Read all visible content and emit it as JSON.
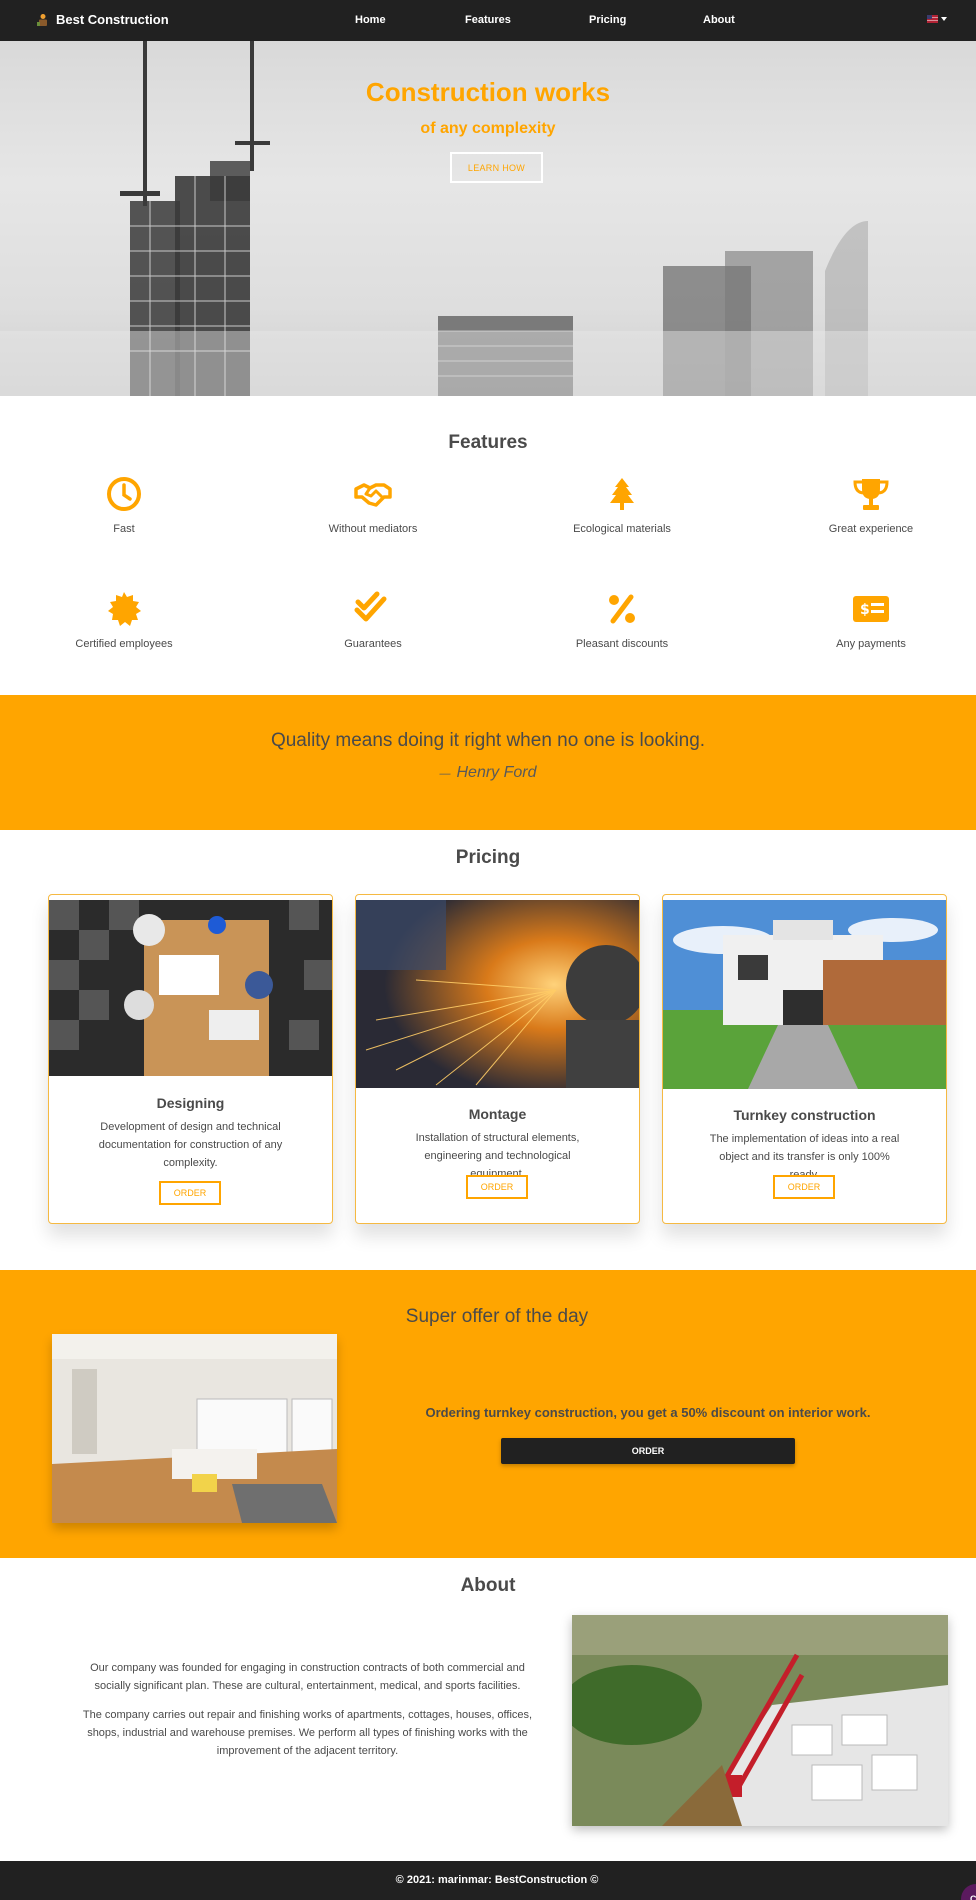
{
  "navbar": {
    "brand": "Best Construction",
    "links": [
      "Home",
      "Features",
      "Pricing",
      "About"
    ],
    "language_icon": "uk-flag-icon",
    "background_color": "#212121"
  },
  "hero": {
    "title": "Construction works",
    "subtitle": "of any complexity",
    "button_label": "LEARN HOW",
    "accent_color": "#ffa500"
  },
  "features": {
    "title": "Features",
    "items": [
      {
        "label": "Fast",
        "icon": "clock-icon"
      },
      {
        "label": "Without mediators",
        "icon": "handshake-icon"
      },
      {
        "label": "Ecological materials",
        "icon": "tree-icon"
      },
      {
        "label": "Great experience",
        "icon": "trophy-icon"
      },
      {
        "label": "Certified employees",
        "icon": "certificate-icon"
      },
      {
        "label": "Guarantees",
        "icon": "double-check-icon"
      },
      {
        "label": "Pleasant discounts",
        "icon": "percent-icon"
      },
      {
        "label": "Any payments",
        "icon": "money-check-icon"
      }
    ]
  },
  "quote": {
    "text": "Quality means doing it right when no one is looking.",
    "dash": "—",
    "author": "Henry Ford",
    "background_color": "#ffa500"
  },
  "pricing": {
    "title": "Pricing",
    "cards": [
      {
        "title": "Designing",
        "text": "Development of design and technical documentation for construction of any complexity.",
        "button": "ORDER"
      },
      {
        "title": "Montage",
        "text": "Installation of structural elements, engineering and technological equipment.",
        "button": "ORDER"
      },
      {
        "title": "Turnkey construction",
        "text": "The implementation of ideas into a real object and its transfer is only 100% ready.",
        "button": "ORDER"
      }
    ]
  },
  "offer": {
    "title": "Super offer of the day",
    "text": "Ordering turnkey construction, you get a 50% discount on interior work.",
    "button": "ORDER"
  },
  "about": {
    "title": "About",
    "paragraphs": [
      "Our company was founded for engaging in construction contracts of both commercial and socially significant plan. These are cultural, entertainment, medical, and sports facilities.",
      "The company carries out repair and finishing works of apartments, cottages, houses, offices, shops, industrial and warehouse premises. We perform all types of finishing works with the improvement of the adjacent territory."
    ]
  },
  "footer": {
    "text": "© 2021: marinmar: BestConstruction ©",
    "badge": "C"
  }
}
